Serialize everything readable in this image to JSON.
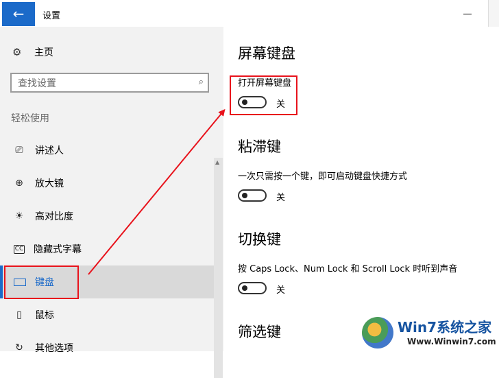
{
  "window": {
    "title": "设置"
  },
  "sidebar": {
    "home_label": "主页",
    "search_placeholder": "查找设置",
    "section": "轻松使用",
    "items": [
      {
        "label": "讲述人",
        "icon": "narrator-icon"
      },
      {
        "label": "放大镜",
        "icon": "magnifier-icon"
      },
      {
        "label": "高对比度",
        "icon": "brightness-icon"
      },
      {
        "label": "隐藏式字幕",
        "icon": "cc-icon"
      },
      {
        "label": "键盘",
        "icon": "keyboard-icon",
        "selected": true
      },
      {
        "label": "鼠标",
        "icon": "mouse-icon"
      },
      {
        "label": "其他选项",
        "icon": "other-options-icon"
      }
    ]
  },
  "main": {
    "sections": [
      {
        "title": "屏幕键盘",
        "desc": "打开屏幕键盘",
        "toggle": "关"
      },
      {
        "title": "粘滞键",
        "desc": "一次只需按一个键，即可启动键盘快捷方式",
        "toggle": "关"
      },
      {
        "title": "切换键",
        "desc": "按 Caps Lock、Num Lock 和 Scroll Lock 时听到声音",
        "toggle": "关"
      },
      {
        "title": "筛选键"
      }
    ]
  },
  "watermark": {
    "title": "Win7系统之家",
    "url": "Www.Winwin7.com"
  },
  "colors": {
    "accent": "#1b6ac9",
    "annotation": "#e8121b"
  }
}
